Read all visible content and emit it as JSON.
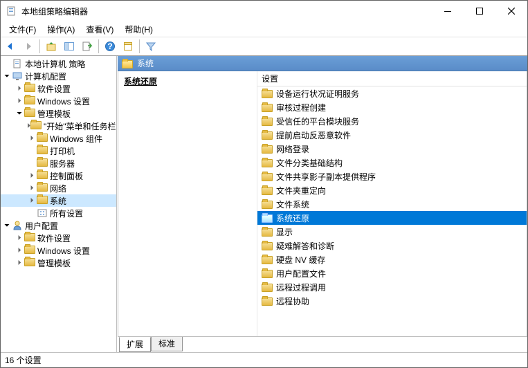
{
  "window": {
    "title": "本地组策略编辑器"
  },
  "menu": {
    "file": "文件(F)",
    "action": "操作(A)",
    "view": "查看(V)",
    "help": "帮助(H)"
  },
  "tree": {
    "root": "本地计算机 策略",
    "computer_config": "计算机配置",
    "cc_software": "软件设置",
    "cc_windows": "Windows 设置",
    "cc_admin": "管理模板",
    "start_menu": "\"开始\"菜单和任务栏",
    "win_components": "Windows 组件",
    "printers": "打印机",
    "servers": "服务器",
    "control_panel": "控制面板",
    "network": "网络",
    "system": "系统",
    "all_settings": "所有设置",
    "user_config": "用户配置",
    "uc_software": "软件设置",
    "uc_windows": "Windows 设置",
    "uc_admin": "管理模板"
  },
  "right": {
    "header": "系统",
    "selected_title": "系统还原",
    "column": "设置",
    "items": [
      "设备运行状况证明服务",
      "审核过程创建",
      "受信任的平台模块服务",
      "提前启动反恶意软件",
      "网络登录",
      "文件分类基础结构",
      "文件共享影子副本提供程序",
      "文件夹重定向",
      "文件系统",
      "系统还原",
      "显示",
      "疑难解答和诊断",
      "硬盘 NV 缓存",
      "用户配置文件",
      "远程过程调用",
      "远程协助"
    ],
    "selected_index": 9
  },
  "tabs": {
    "ext": "扩展",
    "std": "标准"
  },
  "status": "16 个设置"
}
